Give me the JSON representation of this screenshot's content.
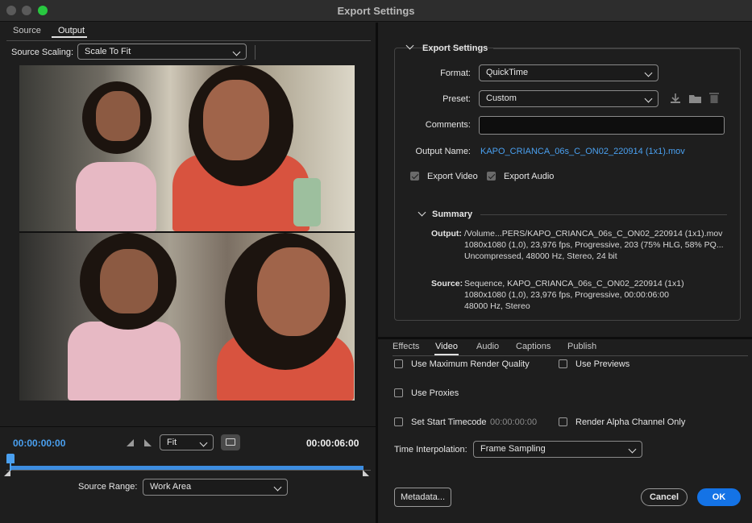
{
  "window": {
    "title": "Export Settings"
  },
  "left": {
    "tabs": [
      {
        "label": "Source"
      },
      {
        "label": "Output"
      }
    ],
    "source_scaling": {
      "label": "Source Scaling:",
      "value": "Scale To Fit"
    },
    "timecode_start": "00:00:00:00",
    "timecode_end": "00:00:06:00",
    "zoom": {
      "value": "Fit"
    },
    "source_range": {
      "label": "Source Range:",
      "value": "Work Area"
    }
  },
  "export_settings": {
    "header": "Export Settings",
    "format": {
      "label": "Format:",
      "value": "QuickTime"
    },
    "preset": {
      "label": "Preset:",
      "value": "Custom"
    },
    "comments": {
      "label": "Comments:",
      "value": ""
    },
    "output_name": {
      "label": "Output Name:",
      "value": "KAPO_CRIANCA_06s_C_ON02_220914 (1x1).mov"
    },
    "export_video": {
      "label": "Export Video",
      "checked": true
    },
    "export_audio": {
      "label": "Export Audio",
      "checked": true
    },
    "summary": {
      "header": "Summary",
      "output_key": "Output:",
      "output_lines": [
        "/Volume...PERS/KAPO_CRIANCA_06s_C_ON02_220914 (1x1).mov",
        "1080x1080 (1,0), 23,976 fps, Progressive, 203 (75% HLG, 58% PQ...",
        "Uncompressed, 48000 Hz, Stereo, 24 bit"
      ],
      "source_key": "Source:",
      "source_lines": [
        "Sequence, KAPO_CRIANCA_06s_C_ON02_220914 (1x1)",
        "1080x1080 (1,0), 23,976 fps, Progressive, 00:00:06:00",
        "48000 Hz, Stereo"
      ]
    }
  },
  "bottom_tabs": [
    {
      "label": "Effects"
    },
    {
      "label": "Video"
    },
    {
      "label": "Audio"
    },
    {
      "label": "Captions"
    },
    {
      "label": "Publish"
    }
  ],
  "video_options": {
    "max_render_quality": {
      "label": "Use Maximum Render Quality",
      "checked": false
    },
    "use_previews": {
      "label": "Use Previews",
      "checked": false
    },
    "use_proxies": {
      "label": "Use Proxies",
      "checked": false
    },
    "start_timecode": {
      "label": "Set Start Timecode",
      "checked": false,
      "value": "00:00:00:00"
    },
    "render_alpha": {
      "label": "Render Alpha Channel Only",
      "checked": false
    },
    "time_interpolation": {
      "label": "Time Interpolation:",
      "value": "Frame Sampling"
    }
  },
  "buttons": {
    "metadata": "Metadata...",
    "cancel": "Cancel",
    "ok": "OK"
  },
  "colors": {
    "accent": "#1473e6",
    "link": "#4aa0f0",
    "background": "#1e1e1e"
  }
}
